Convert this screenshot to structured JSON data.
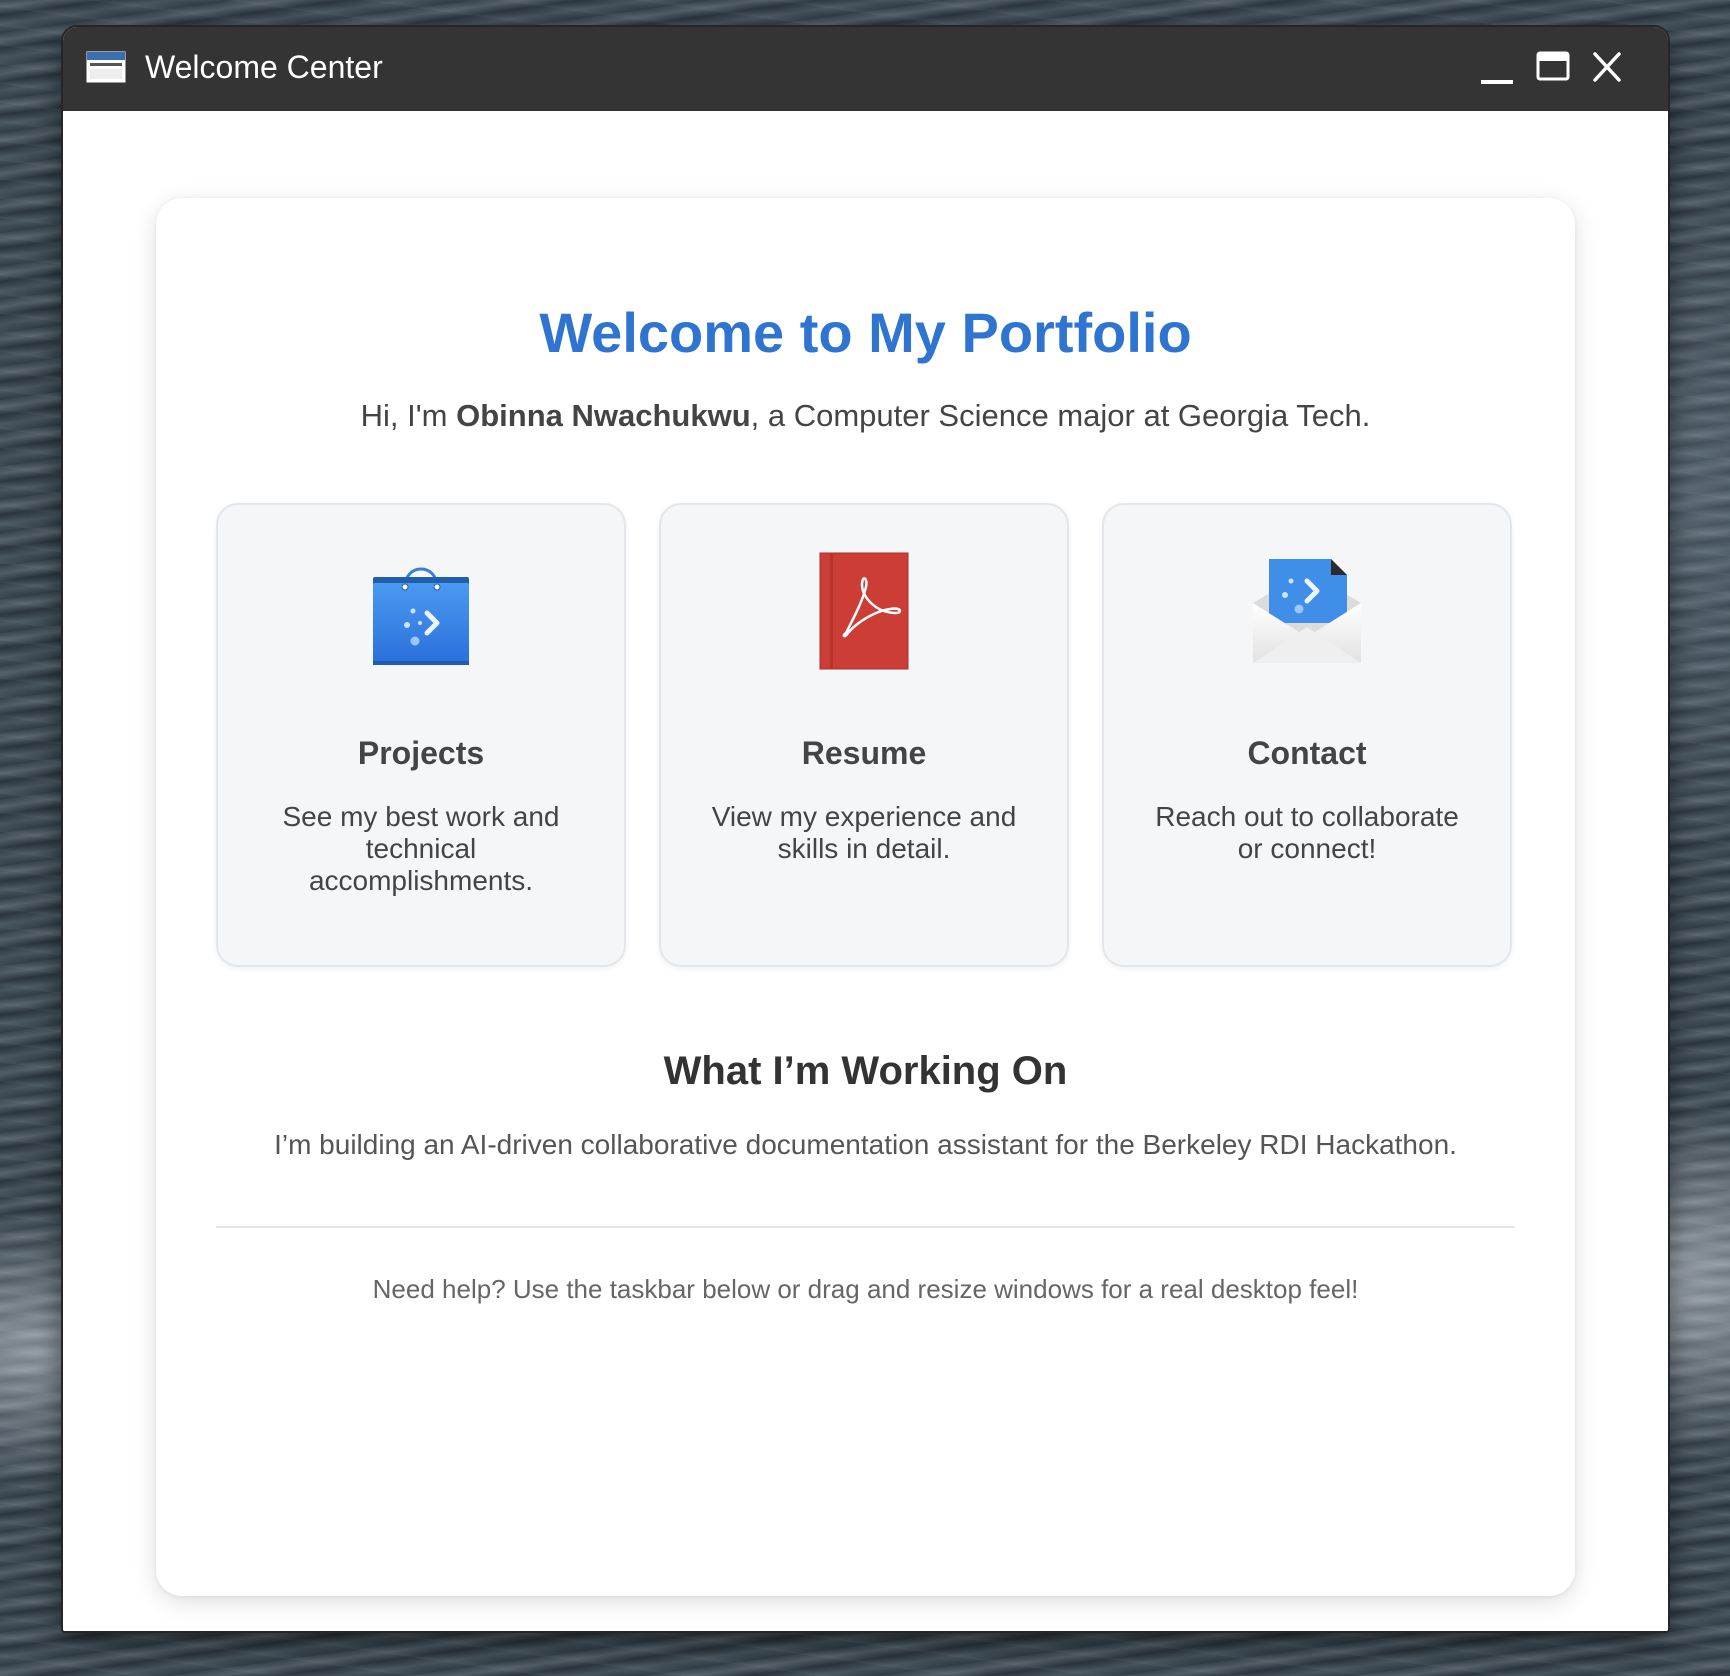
{
  "window": {
    "title": "Welcome Center",
    "icon": "app-window-icon",
    "controls": [
      "minimize-icon",
      "maximize-icon",
      "close-icon"
    ]
  },
  "hero": {
    "title": "Welcome to My Portfolio",
    "intro_prefix": "Hi, I'm ",
    "intro_name": "Obinna Nwachukwu",
    "intro_suffix": ", a Computer Science major at Georgia Tech."
  },
  "tiles": [
    {
      "icon": "shopping-bag-icon",
      "title": "Projects",
      "description": "See my best work and technical accomplishments."
    },
    {
      "icon": "pdf-book-icon",
      "title": "Resume",
      "description": "View my experience and skills in detail."
    },
    {
      "icon": "mail-envelope-icon",
      "title": "Contact",
      "description": "Reach out to collaborate or connect!"
    }
  ],
  "working_on": {
    "title": "What I’m Working On",
    "text": "I’m building an AI-driven collaborative documentation assistant for the Berkeley RDI Hackathon."
  },
  "footer": {
    "note": "Need help? Use the taskbar below or drag and resize windows for a real desktop feel!"
  },
  "colors": {
    "accent": "#2f74d0",
    "titlebar": "#343434",
    "tile_background": "#f5f6f8"
  }
}
